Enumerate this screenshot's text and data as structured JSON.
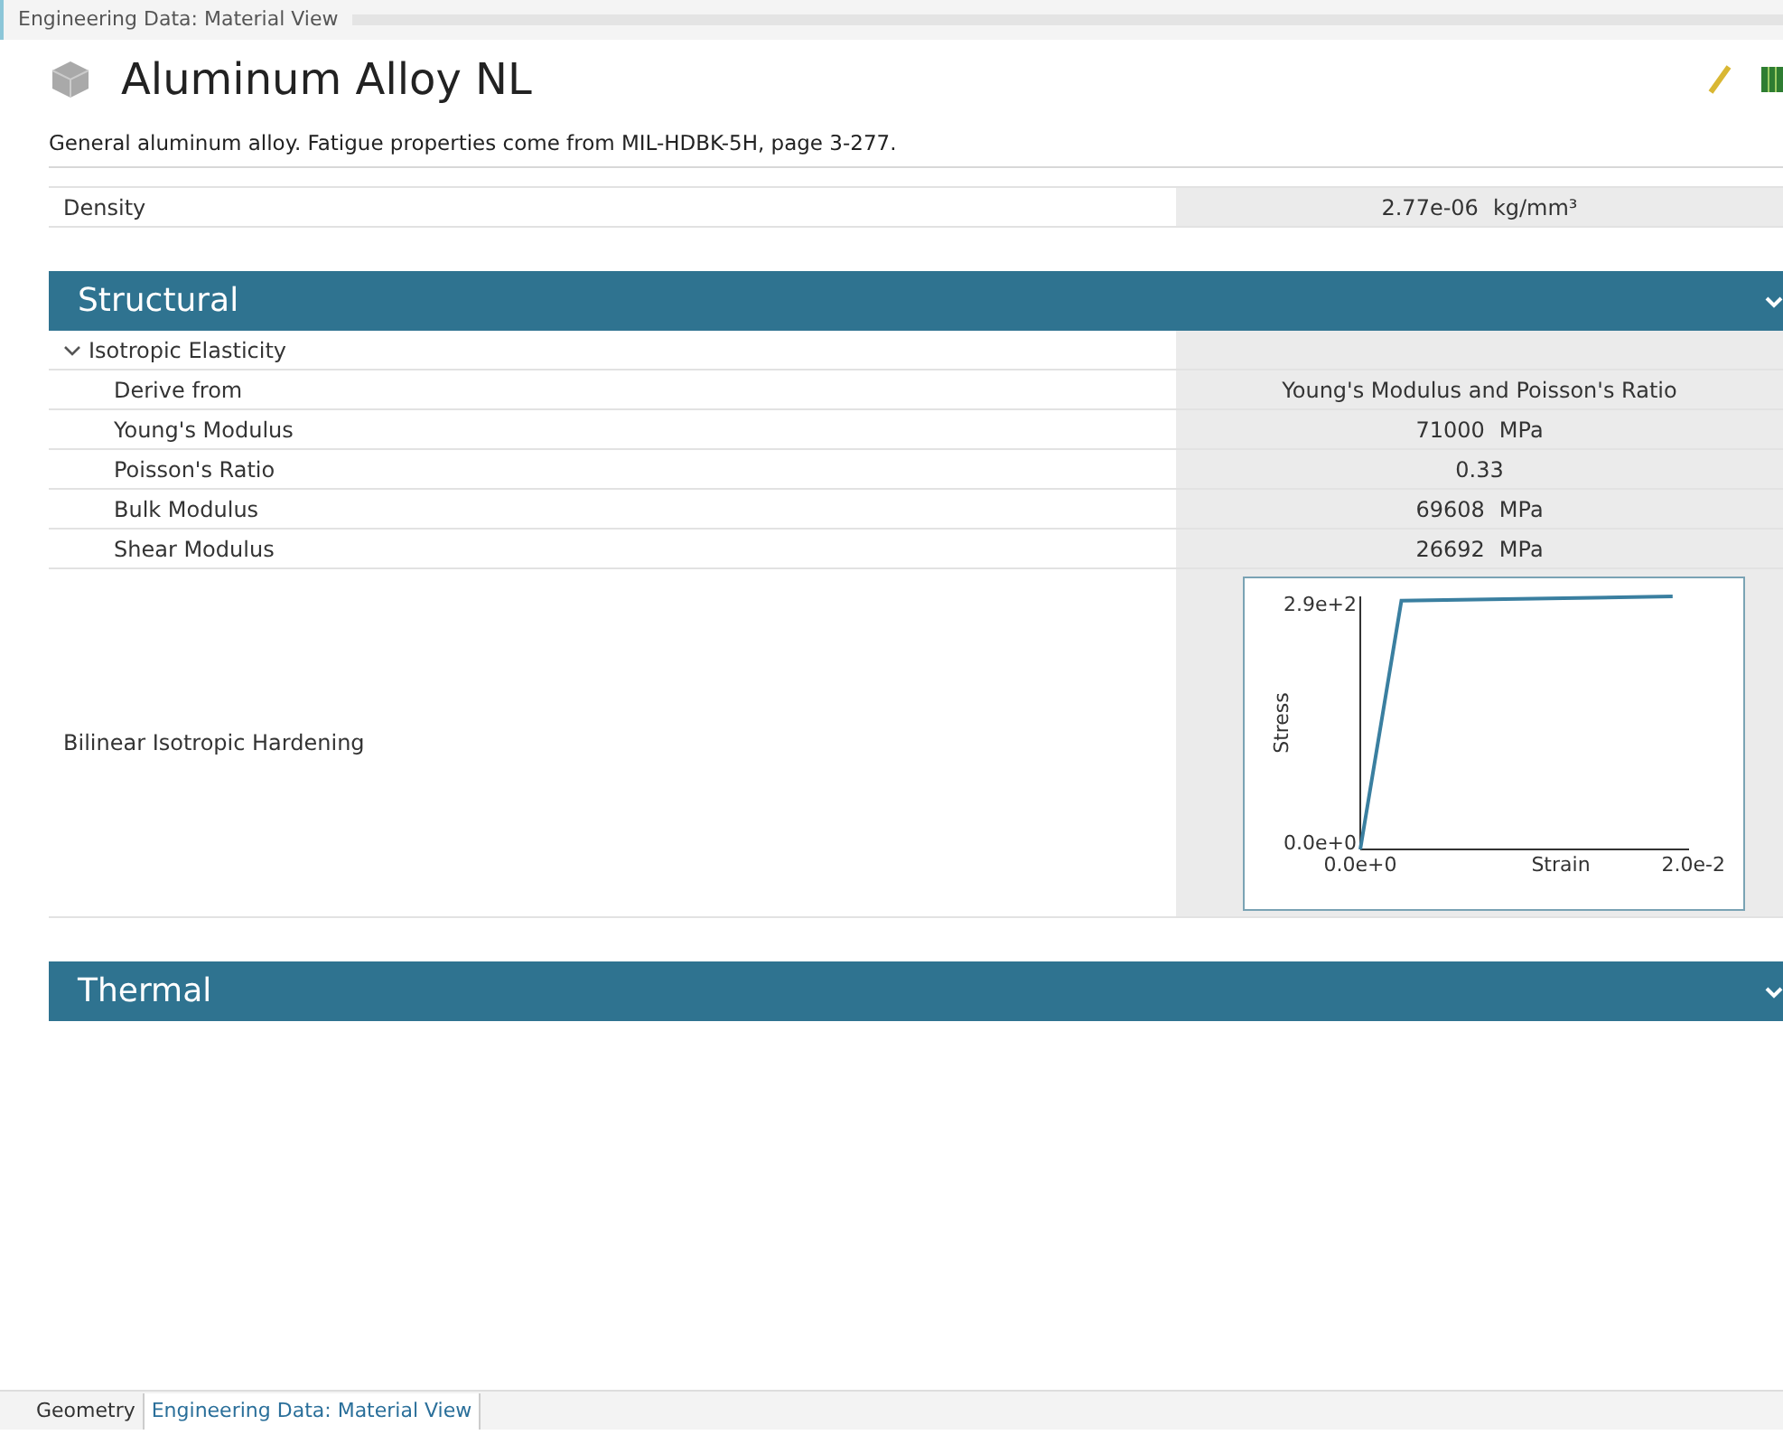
{
  "window": {
    "title": "Engineering Data: Material View"
  },
  "material": {
    "name": "Aluminum Alloy NL",
    "description": "General aluminum alloy. Fatigue properties come from MIL-HDBK-5H, page 3-277."
  },
  "top_properties": [
    {
      "label": "Density",
      "value": "2.77e-06",
      "unit": "kg/mm³"
    }
  ],
  "sections": [
    {
      "title": "Structural",
      "groups": [
        {
          "title": "Isotropic Elasticity",
          "expanded": true,
          "rows": [
            {
              "label": "Derive from",
              "value": "Young's Modulus and Poisson's Ratio"
            },
            {
              "label": "Young's Modulus",
              "value": "71000",
              "unit": "MPa"
            },
            {
              "label": "Poisson's Ratio",
              "value": "0.33"
            },
            {
              "label": "Bulk Modulus",
              "value": "69608",
              "unit": "MPa"
            },
            {
              "label": "Shear Modulus",
              "value": "26692",
              "unit": "MPa"
            }
          ]
        }
      ],
      "chart_row": {
        "label": "Bilinear Isotropic Hardening",
        "chart_data": {
          "type": "line",
          "xlabel": "Strain",
          "ylabel": "Stress",
          "x": [
            0,
            0.0025,
            0.019
          ],
          "series": [
            {
              "color": "#3a7fa0",
              "values": [
                0,
                285,
                290
              ]
            }
          ],
          "xlim": [
            0,
            0.02
          ],
          "ylim": [
            0,
            290
          ],
          "xticks": [
            {
              "value": 0,
              "label": "0.0e+0"
            },
            {
              "value": 0.02,
              "label": "2.0e-2"
            }
          ],
          "yticks": [
            {
              "value": 0,
              "label": "0.0e+0"
            },
            {
              "value": 290,
              "label": "2.9e+2"
            }
          ]
        }
      }
    },
    {
      "title": "Thermal"
    }
  ],
  "bottom_tabs": [
    {
      "label": "Geometry",
      "selected": false
    },
    {
      "label": "Engineering Data: Material View",
      "selected": true
    }
  ]
}
